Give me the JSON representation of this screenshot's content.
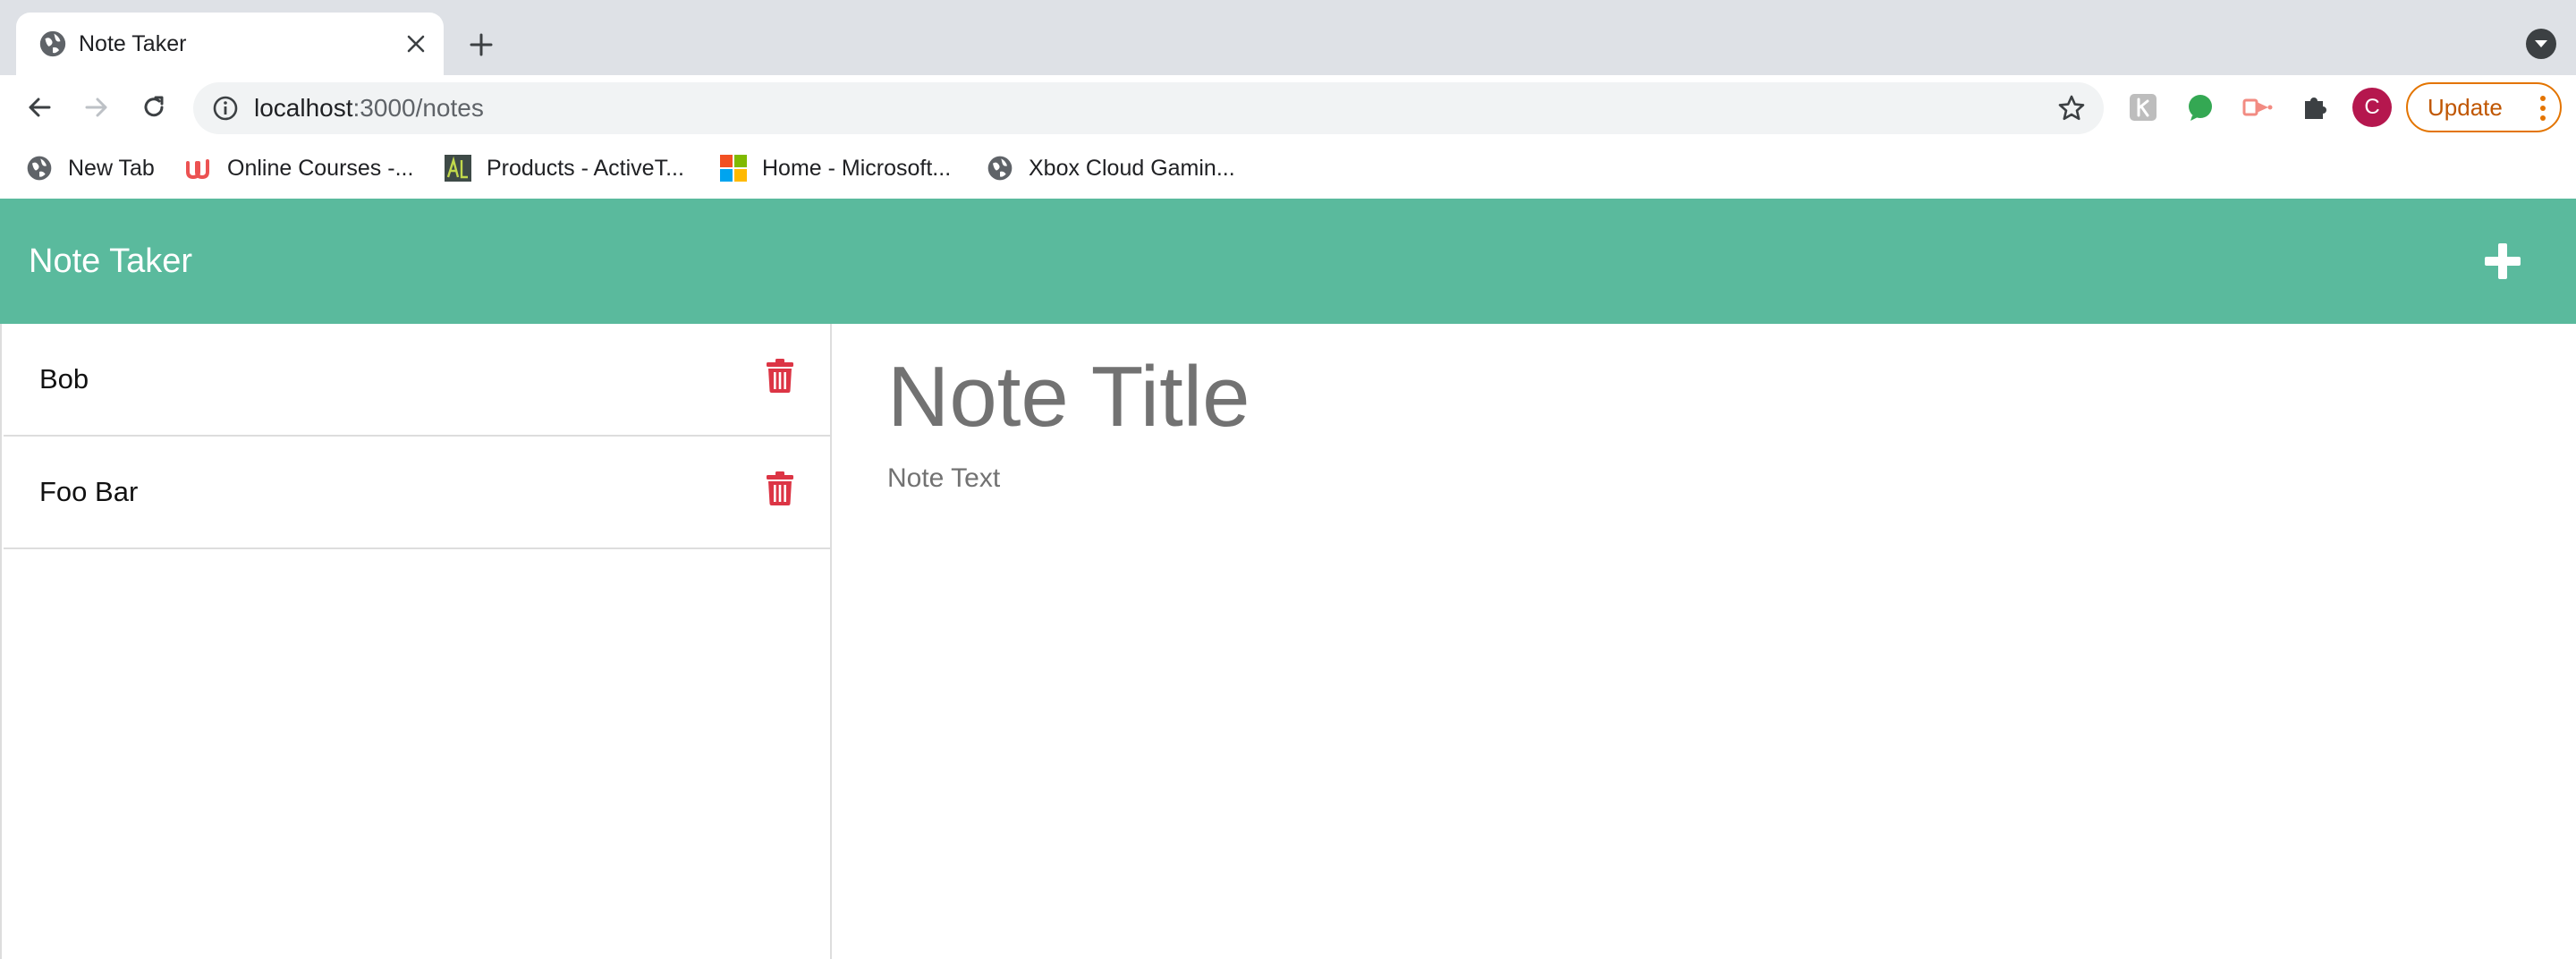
{
  "browser": {
    "tab": {
      "title": "Note Taker"
    },
    "address_bar": {
      "host": "localhost",
      "path": ":3000/notes"
    },
    "profile_initial": "C",
    "update_label": "Update",
    "bookmarks": [
      {
        "label": "New Tab",
        "icon": "globe-icon"
      },
      {
        "label": "Online Courses -...",
        "icon": "udemy-icon"
      },
      {
        "label": "Products - ActiveT...",
        "icon": "activestate-icon"
      },
      {
        "label": "Home - Microsoft...",
        "icon": "microsoft-icon"
      },
      {
        "label": "Xbox Cloud Gamin...",
        "icon": "globe-icon"
      }
    ]
  },
  "app": {
    "brand": "Note Taker",
    "notes": [
      {
        "title": "Bob"
      },
      {
        "title": "Foo Bar"
      }
    ],
    "editor": {
      "title_placeholder": "Note Title",
      "text_placeholder": "Note Text"
    }
  },
  "colors": {
    "navbar": "#5aba9d",
    "trash": "#dc3545",
    "update_accent": "#e37400",
    "avatar": "#b5174e"
  }
}
